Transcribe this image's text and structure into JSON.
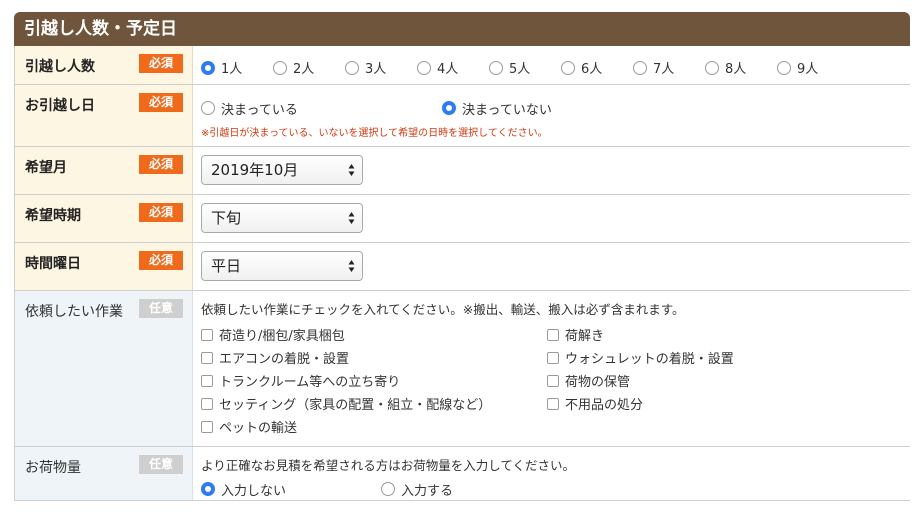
{
  "section": {
    "title": "引越し人数・予定日"
  },
  "badges": {
    "required": "必須",
    "optional": "任意"
  },
  "people": {
    "label": "引越し人数",
    "options": [
      "1人",
      "2人",
      "3人",
      "4人",
      "5人",
      "6人",
      "7人",
      "8人",
      "9人"
    ],
    "selected_index": 0
  },
  "move_date": {
    "label": "お引越し日",
    "options": [
      "決まっている",
      "決まっていない"
    ],
    "selected_index": 1,
    "notice": "※引越日が決まっている、いないを選択して希望の日時を選択してください。"
  },
  "month": {
    "label": "希望月",
    "value": "2019年10月"
  },
  "period": {
    "label": "希望時期",
    "value": "下旬"
  },
  "weekday": {
    "label": "時間曜日",
    "value": "平日"
  },
  "tasks": {
    "label": "依頼したい作業",
    "instruction": "依頼したい作業にチェックを入れてください。※搬出、輸送、搬入は必ず含まれます。",
    "items": [
      "荷造り/梱包/家具梱包",
      "荷解き",
      "エアコンの着脱・設置",
      "ウォシュレットの着脱・設置",
      "トランクルーム等への立ち寄り",
      "荷物の保管",
      "セッティング（家具の配置・組立・配線など）",
      "不用品の処分",
      "ペットの輸送"
    ]
  },
  "luggage": {
    "label": "お荷物量",
    "instruction": "より正確なお見積を希望される方はお荷物量を入力してください。",
    "options": [
      "入力しない",
      "入力する"
    ],
    "selected_index": 0
  },
  "colors": {
    "header": "#6f553c",
    "required": "#ef6a1a",
    "radio_on": "#2f7cf0",
    "notice": "#d23a12"
  }
}
